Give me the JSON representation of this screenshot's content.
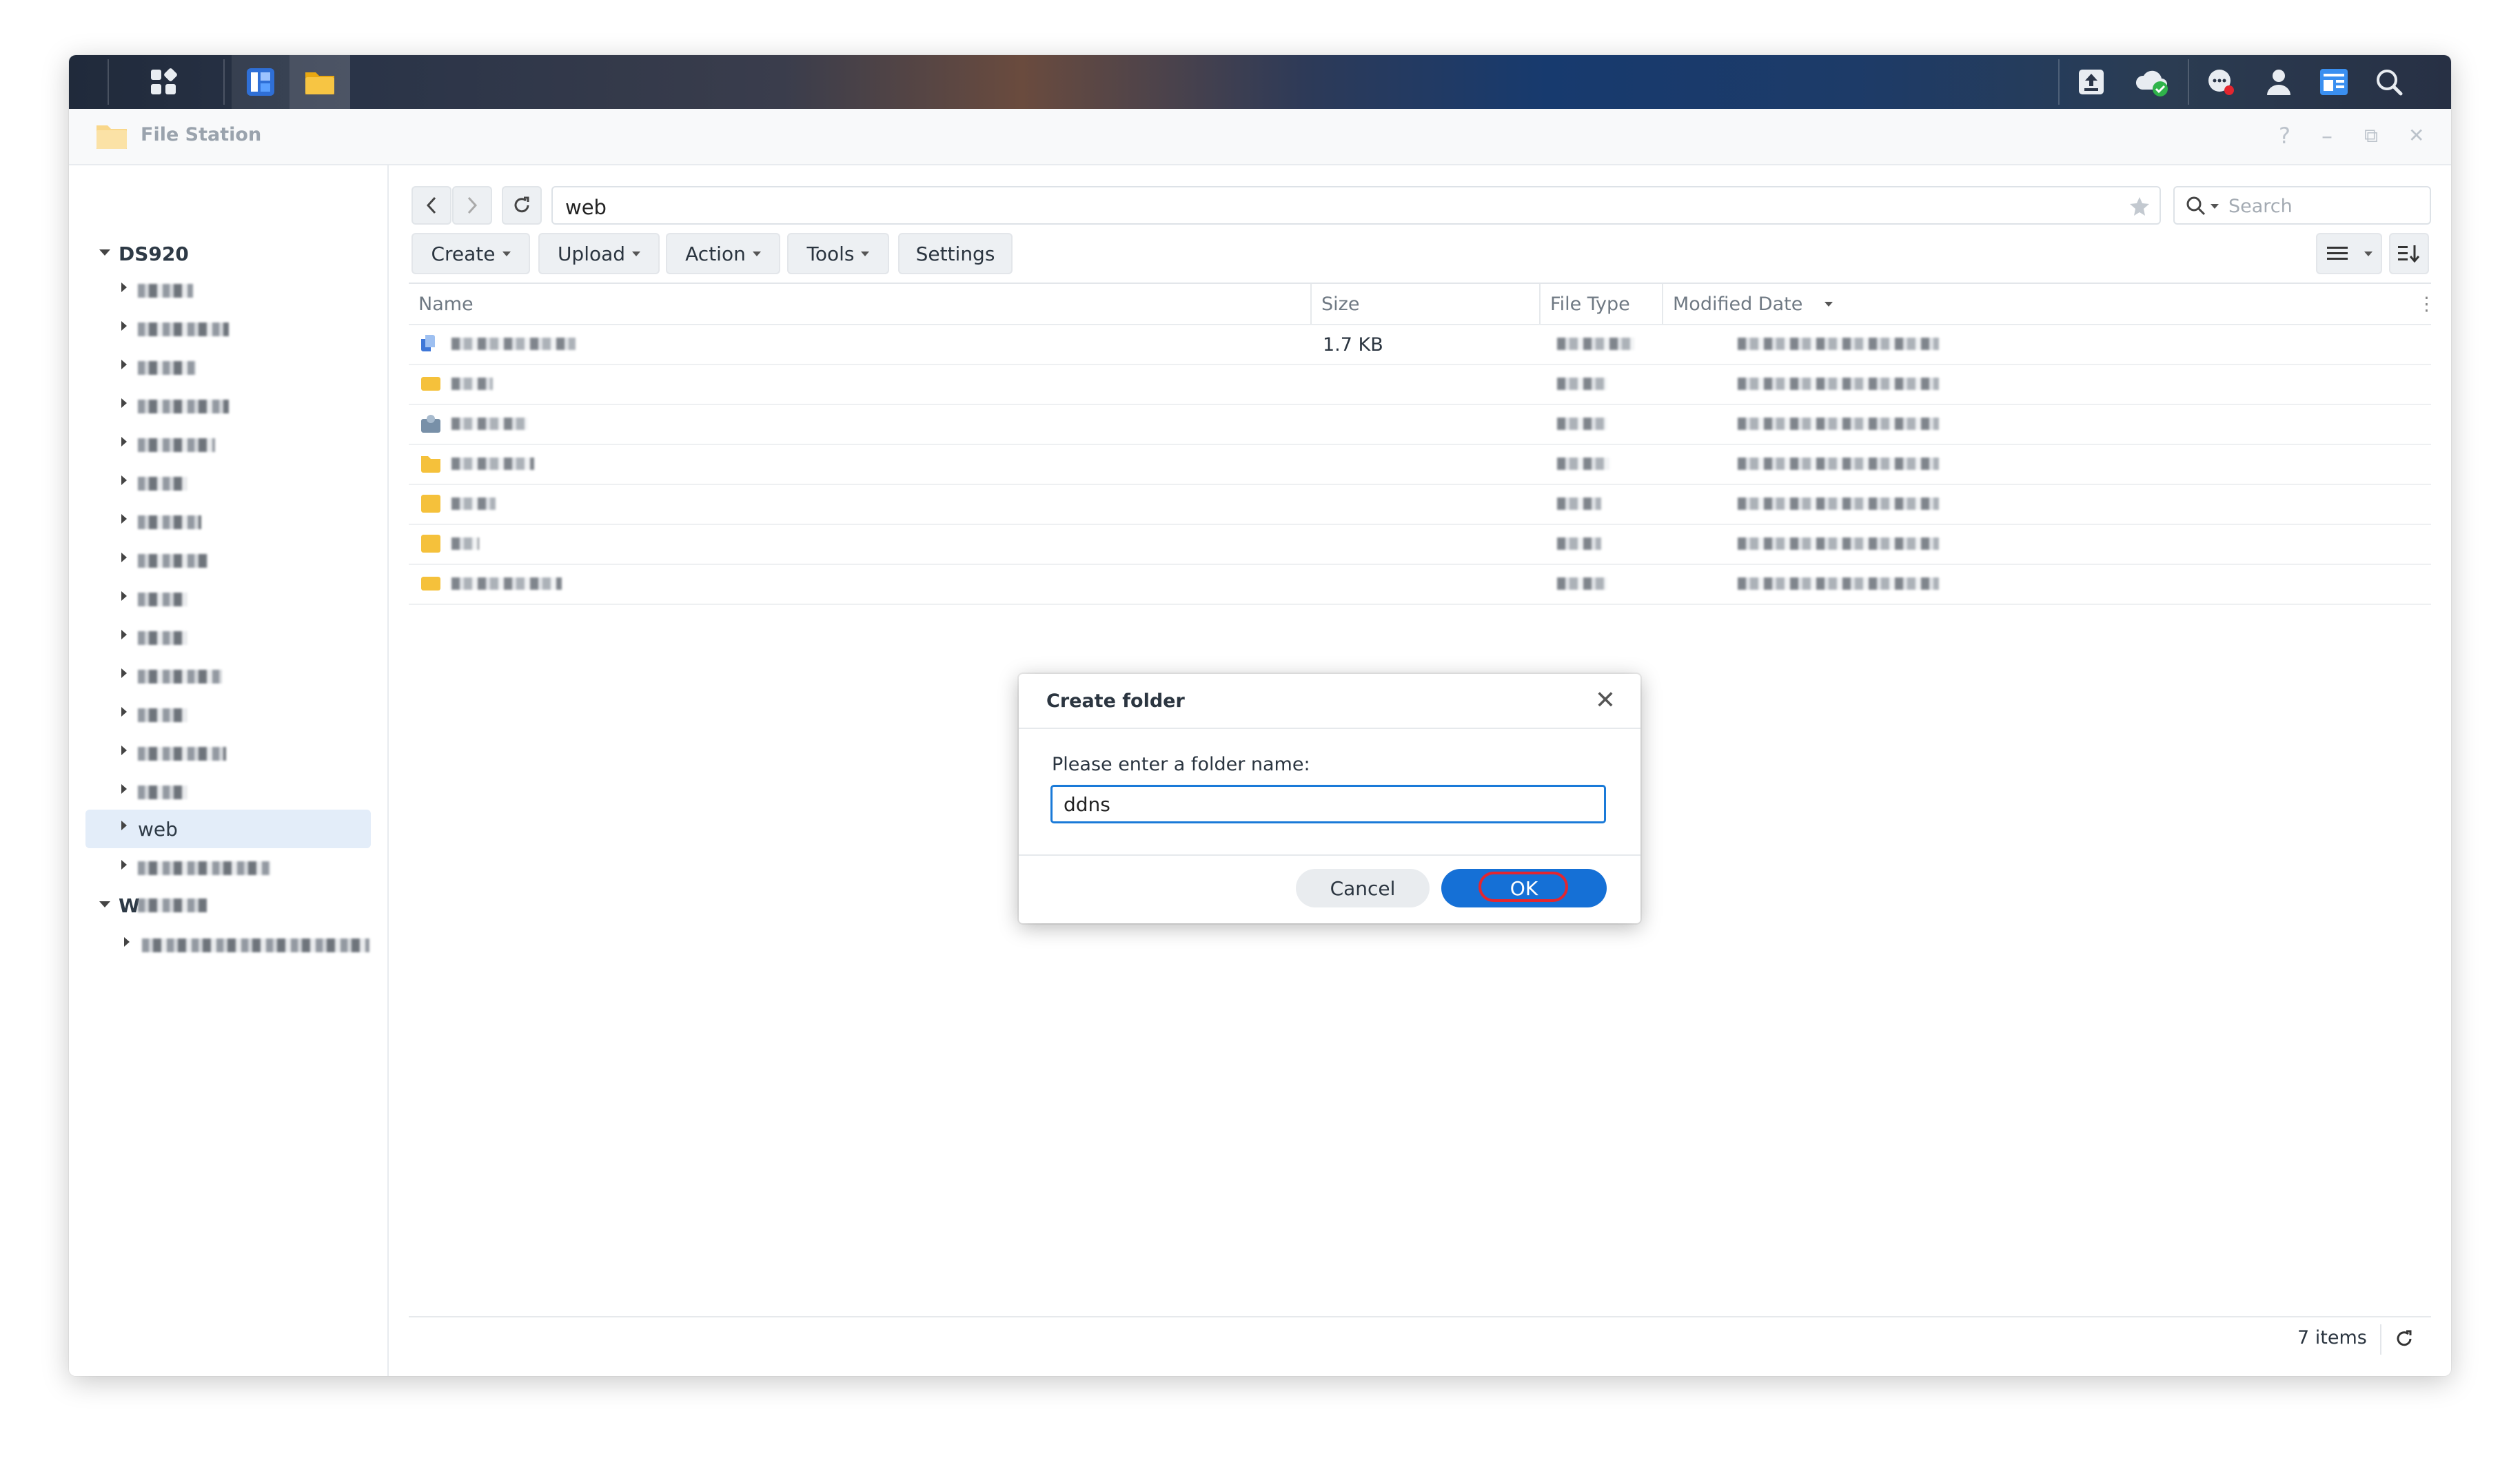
{
  "taskbar": {
    "left_icons": [
      "main-menu-icon",
      "package-center-icon",
      "file-station-icon"
    ],
    "right_icons": [
      "upload-icon",
      "cloud-sync-icon",
      "notifications-icon",
      "user-icon",
      "widgets-icon",
      "search-icon"
    ]
  },
  "window": {
    "title": "File Station",
    "controls": {
      "help": "?",
      "minimize": "–",
      "maximize": "⧉",
      "close": "✕"
    }
  },
  "sidebar": {
    "root1": "DS920",
    "root1_children_count_shown": 16,
    "selected_item": "web",
    "root2": "W"
  },
  "toolbar": {
    "path": "web",
    "search_placeholder": "Search",
    "buttons": [
      "Create",
      "Upload",
      "Action",
      "Tools",
      "Settings"
    ]
  },
  "list": {
    "columns": [
      "Name",
      "Size",
      "File Type",
      "Modified Date"
    ],
    "rows": [
      {
        "size": "1.7 KB"
      },
      {
        "size": ""
      },
      {
        "size": ""
      },
      {
        "size": ""
      },
      {
        "size": ""
      },
      {
        "size": ""
      },
      {
        "size": ""
      }
    ]
  },
  "footer": {
    "items": "7 items"
  },
  "dialog": {
    "title": "Create folder",
    "label": "Please enter a folder name:",
    "input_value": "ddns",
    "cancel": "Cancel",
    "ok": "OK"
  },
  "colors": {
    "accent": "#1570d6",
    "highlight_ring": "#e3262f",
    "folder": "#f5c13b",
    "selected_bg": "#e3edf9"
  }
}
